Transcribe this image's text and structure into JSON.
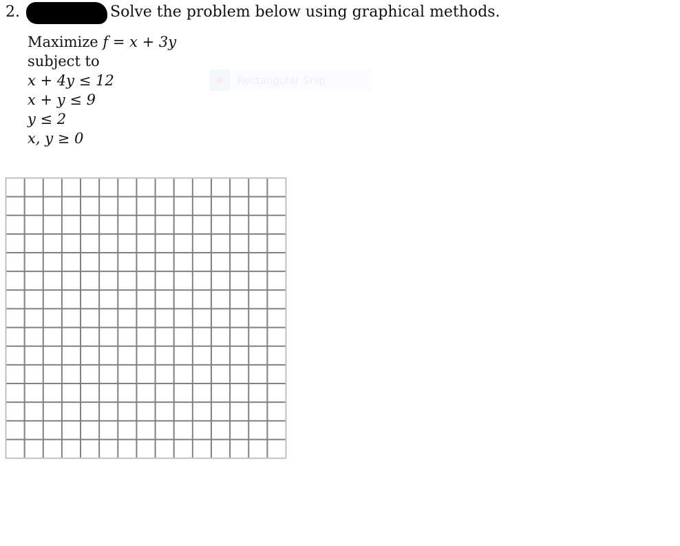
{
  "question": {
    "number": "2.",
    "redacted": true,
    "heading": "Solve the problem below using graphical methods."
  },
  "problem": {
    "objective": "Maximize f = x + 3y",
    "objective_parts": {
      "verb": "Maximize",
      "expr": "f = x + 3y"
    },
    "subject_to": "subject to",
    "constraints": [
      "x + 4y ≤ 12",
      "x + y ≤ 9",
      "y ≤ 2",
      "x,  y ≥ 0"
    ]
  },
  "overlay": {
    "label": "Rectangular Snip",
    "icon": "snip-icon"
  },
  "graph_paper": {
    "columns": 15,
    "rows": 15,
    "border_color": "#c0c0c0",
    "line_color": "#808080"
  }
}
